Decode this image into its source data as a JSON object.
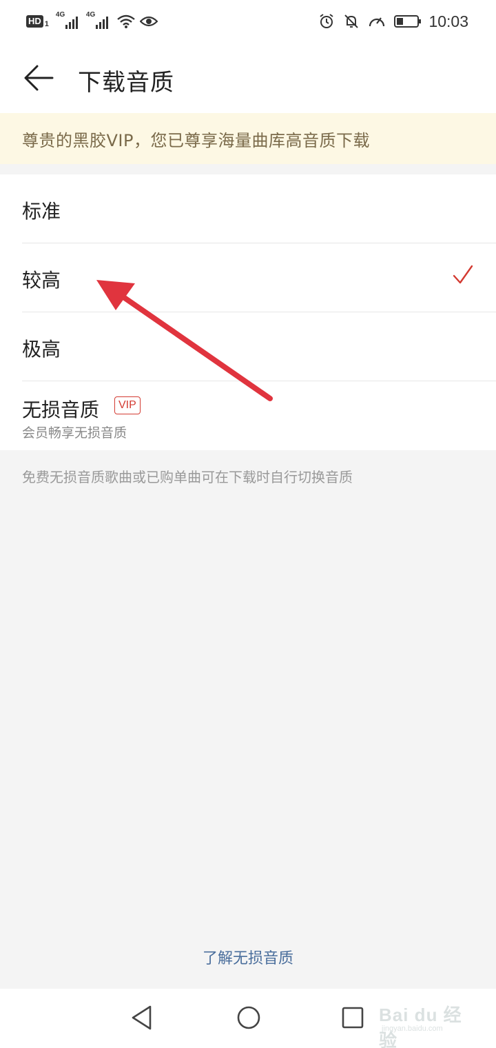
{
  "status_bar": {
    "hd_label": "HD",
    "sim_number": "1",
    "network_1": "4G",
    "network_2": "4G",
    "time": "10:03",
    "icons": [
      "hd-icon",
      "signal-icon",
      "signal-icon",
      "wifi-icon",
      "eye-icon",
      "alarm-icon",
      "bell-off-icon",
      "speed-icon",
      "battery-icon"
    ]
  },
  "header": {
    "title": "下载音质",
    "back_icon": "arrow-left-icon"
  },
  "vip_banner": {
    "text": "尊贵的黑胶VIP，您已尊享海量曲库高音质下载"
  },
  "options": [
    {
      "label": "标准",
      "selected": false
    },
    {
      "label": "较高",
      "selected": true
    },
    {
      "label": "极高",
      "selected": false
    },
    {
      "label": "无损音质",
      "tag": "VIP",
      "subtitle": "会员畅享无损音质",
      "selected": false
    }
  ],
  "footnote": "免费无损音质歌曲或已购单曲可在下载时自行切换音质",
  "learn_link": "了解无损音质",
  "nav_bar": {
    "icons": [
      "back-triangle-icon",
      "home-circle-icon",
      "recents-square-icon"
    ]
  },
  "watermark": {
    "line1": "Bai du 经验",
    "line2": "jingyan.baidu.com"
  },
  "colors": {
    "accent_red": "#d33a31",
    "annotation_arrow": "#e0343e",
    "banner_bg": "#fdf8e4",
    "link_blue": "#4a6e9c"
  }
}
